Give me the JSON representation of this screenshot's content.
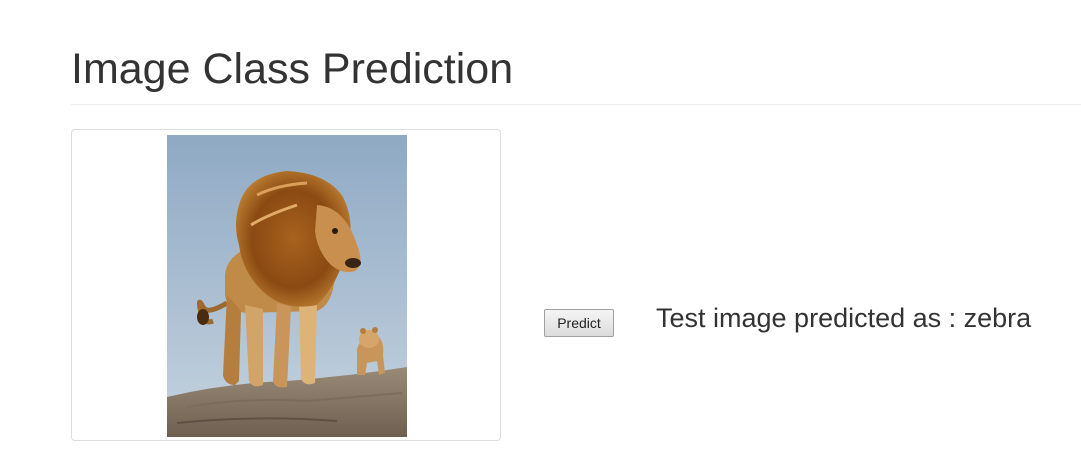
{
  "header": {
    "title": "Image Class Prediction"
  },
  "image_panel": {
    "icon": "lion-photo"
  },
  "actions": {
    "predict_label": "Predict"
  },
  "result": {
    "text": "Test image predicted as : zebra"
  },
  "colors": {
    "text": "#333333",
    "divider": "#eeeeee",
    "panel_border": "#dddddd"
  }
}
